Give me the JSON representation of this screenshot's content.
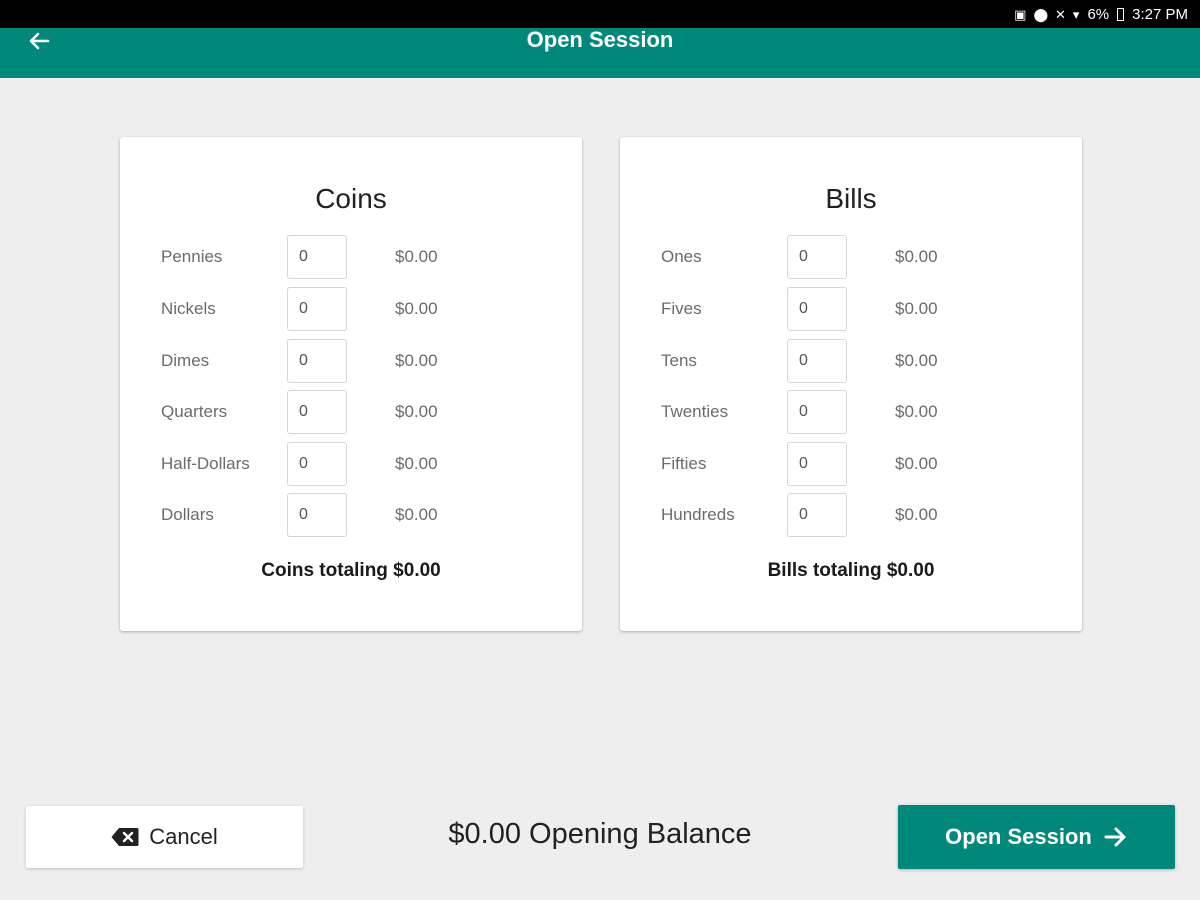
{
  "status_bar": {
    "battery": "6%",
    "time": "3:27 PM",
    "icons": [
      "sim-icon",
      "location-icon",
      "mute-icon",
      "wifi-icon",
      "battery-icon"
    ]
  },
  "app_bar": {
    "title": "Open Session",
    "back_icon": "arrow-left-icon",
    "color": "#00897b"
  },
  "coins": {
    "title": "Coins",
    "rows": [
      {
        "label": "Pennies",
        "count": "0",
        "amount": "$0.00"
      },
      {
        "label": "Nickels",
        "count": "0",
        "amount": "$0.00"
      },
      {
        "label": "Dimes",
        "count": "0",
        "amount": "$0.00"
      },
      {
        "label": "Quarters",
        "count": "0",
        "amount": "$0.00"
      },
      {
        "label": "Half-Dollars",
        "count": "0",
        "amount": "$0.00"
      },
      {
        "label": "Dollars",
        "count": "0",
        "amount": "$0.00"
      }
    ],
    "total": "Coins totaling $0.00"
  },
  "bills": {
    "title": "Bills",
    "rows": [
      {
        "label": "Ones",
        "count": "0",
        "amount": "$0.00"
      },
      {
        "label": "Fives",
        "count": "0",
        "amount": "$0.00"
      },
      {
        "label": "Tens",
        "count": "0",
        "amount": "$0.00"
      },
      {
        "label": "Twenties",
        "count": "0",
        "amount": "$0.00"
      },
      {
        "label": "Fifties",
        "count": "0",
        "amount": "$0.00"
      },
      {
        "label": "Hundreds",
        "count": "0",
        "amount": "$0.00"
      }
    ],
    "total": "Bills totaling $0.00"
  },
  "footer": {
    "cancel_label": "Cancel",
    "cancel_icon": "backspace-icon",
    "opening_balance": "$0.00 Opening Balance",
    "open_label": "Open Session",
    "open_icon": "arrow-right-icon"
  }
}
